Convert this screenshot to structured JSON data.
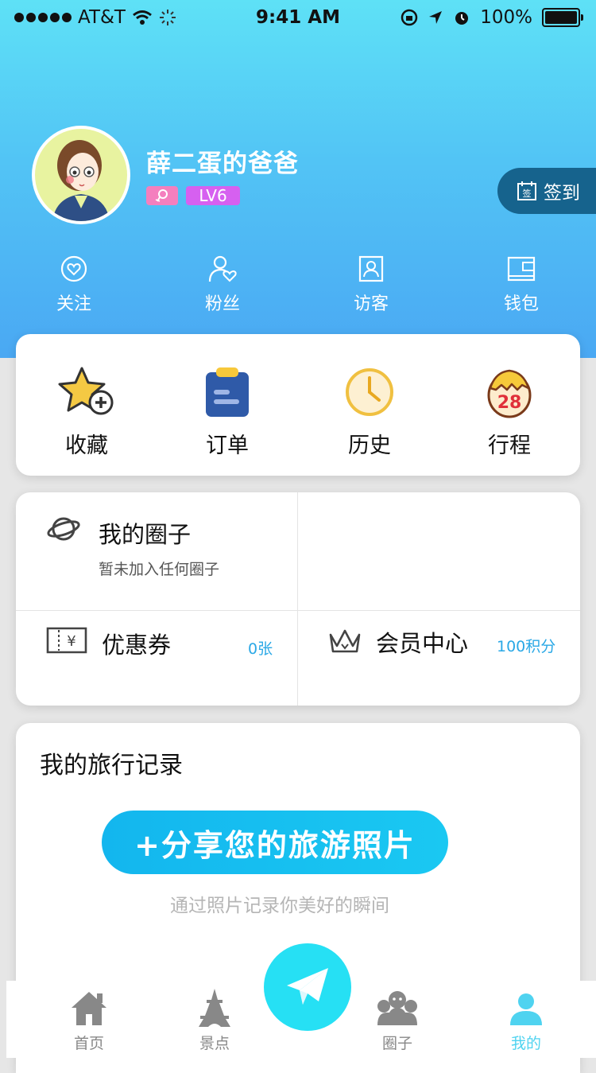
{
  "status_bar": {
    "carrier": "AT&T",
    "time": "9:41 AM",
    "battery": "100%"
  },
  "profile": {
    "username": "薛二蛋的爸爸",
    "level": "LV6",
    "checkin_label": "签到",
    "checkin_icon_text": "签"
  },
  "quick_links": [
    {
      "label": "关注",
      "icon": "heart-circle-icon"
    },
    {
      "label": "粉丝",
      "icon": "fans-icon"
    },
    {
      "label": "访客",
      "icon": "visitor-icon"
    },
    {
      "label": "钱包",
      "icon": "wallet-icon"
    }
  ],
  "features": [
    {
      "label": "收藏",
      "icon": "star-add-icon"
    },
    {
      "label": "订单",
      "icon": "clipboard-icon"
    },
    {
      "label": "历史",
      "icon": "clock-icon"
    },
    {
      "label": "行程",
      "icon": "egg-calendar-icon",
      "badge": "28"
    }
  ],
  "circles": {
    "title": "我的圈子",
    "subtitle": "暂未加入任何圈子"
  },
  "coupons": {
    "title": "优惠券",
    "value": "0张",
    "icon_text": "¥"
  },
  "membership": {
    "title": "会员中心",
    "value": "100积分"
  },
  "travel": {
    "title": "我的旅行记录",
    "share_button": "+分享您的旅游照片",
    "hint": "通过照片记录你美好的瞬间"
  },
  "tabs": [
    {
      "label": "首页",
      "icon": "home-icon",
      "active": false
    },
    {
      "label": "景点",
      "icon": "tower-icon",
      "active": false
    },
    {
      "label": "圈子",
      "icon": "group-icon",
      "active": false
    },
    {
      "label": "我的",
      "icon": "user-icon",
      "active": true
    }
  ],
  "colors": {
    "accent": "#4fd3f0",
    "share_button": "#13b6ee",
    "checkin_bg": "#16638d",
    "level_badge": "#d660f0",
    "fab": "#26e0f4"
  }
}
